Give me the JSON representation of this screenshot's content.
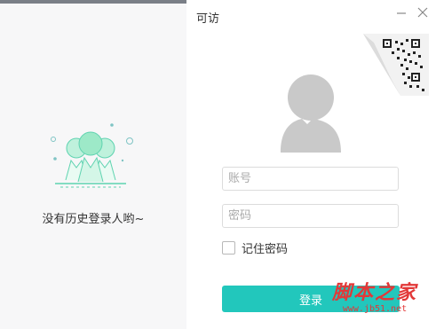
{
  "left_panel": {
    "empty_text": "没有历史登录人哟~"
  },
  "window": {
    "title": "可访",
    "minimize_icon": "minimize-icon",
    "close_icon": "close-icon"
  },
  "login": {
    "account_placeholder": "账号",
    "password_placeholder": "密码",
    "remember_label": "记住密码",
    "login_button": "登录"
  },
  "colors": {
    "accent": "#22c7bc",
    "illustration": "#5fd3b0",
    "avatar": "#c9c9c9"
  },
  "watermark": {
    "title": "脚本之家",
    "url": "www.jb51.net"
  }
}
